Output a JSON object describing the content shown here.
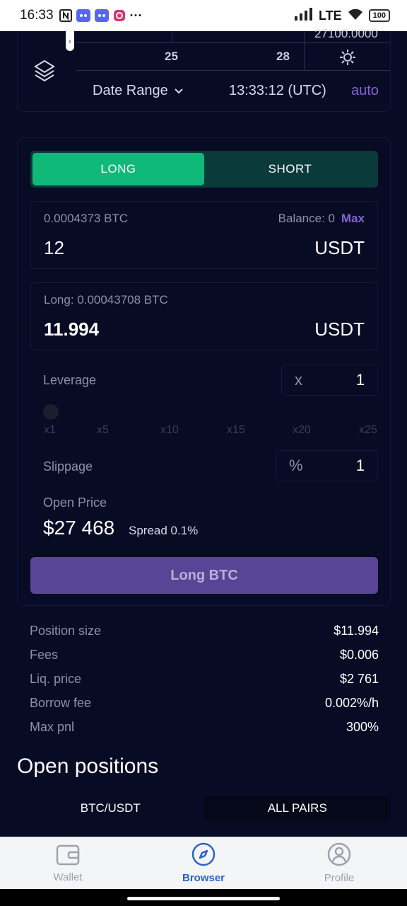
{
  "status_bar": {
    "time": "16:33",
    "network": "LTE",
    "battery": "100"
  },
  "chart": {
    "price_label": "27100.0000",
    "x_ticks": [
      "25",
      "28"
    ],
    "date_range_label": "Date Range",
    "clock": "13:33:12 (UTC)",
    "auto_label": "auto"
  },
  "trade": {
    "long_label": "LONG",
    "short_label": "SHORT",
    "pay_sub": "0.0004373 BTC",
    "balance_label": "Balance: 0",
    "max_label": "Max",
    "pay_value": "12",
    "pay_unit": "USDT",
    "receive_sub": "Long: 0.00043708 BTC",
    "receive_value": "11.994",
    "receive_unit": "USDT",
    "leverage_label": "Leverage",
    "leverage_prefix": "x",
    "leverage_value": "1",
    "leverage_marks": [
      "x1",
      "x5",
      "x10",
      "x15",
      "x20",
      "x25"
    ],
    "slippage_label": "Slippage",
    "slippage_prefix": "%",
    "slippage_value": "1",
    "open_price_label": "Open Price",
    "open_price": "$27 468",
    "spread": "Spread 0.1%",
    "submit_label": "Long BTC"
  },
  "summary": [
    {
      "label": "Position size",
      "value": "$11.994"
    },
    {
      "label": "Fees",
      "value": "$0.006"
    },
    {
      "label": "Liq. price",
      "value": "$2 761"
    },
    {
      "label": "Borrow fee",
      "value": "0.002%/h"
    },
    {
      "label": "Max pnl",
      "value": "300%"
    }
  ],
  "positions": {
    "title": "Open positions",
    "tabs": [
      "BTC/USDT",
      "ALL PAIRS"
    ]
  },
  "nav": {
    "items": [
      "Wallet",
      "Browser",
      "Profile"
    ],
    "active": "Browser",
    "active_color": "#2b63c9"
  },
  "colors": {
    "long_green": "#10b97a",
    "accent_purple": "#8a63d2",
    "background": "#070b24"
  }
}
